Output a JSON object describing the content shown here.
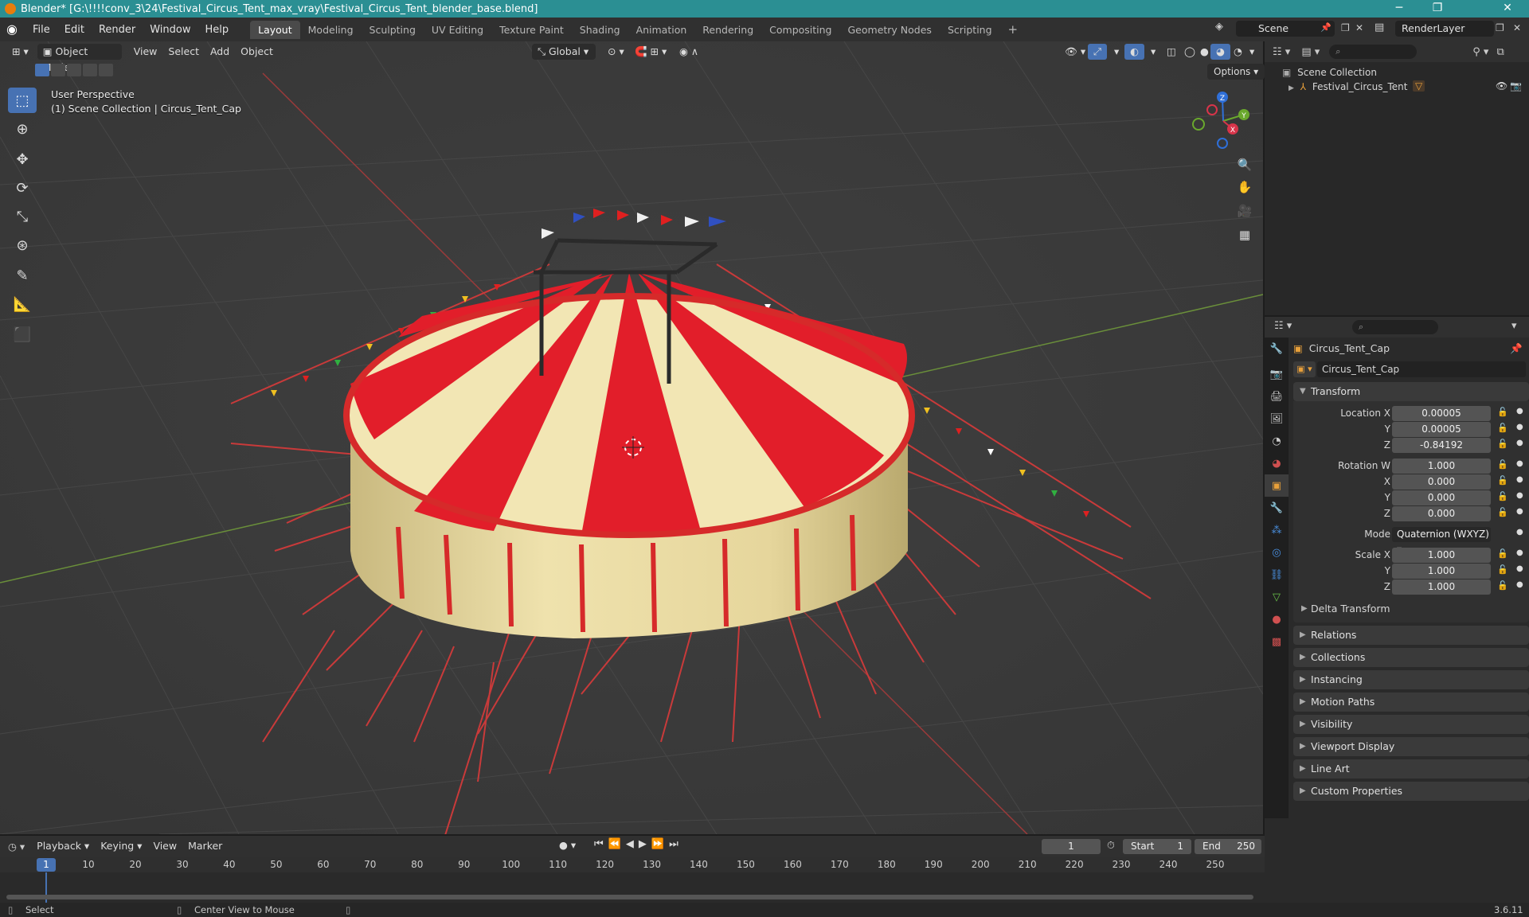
{
  "window": {
    "title": "Blender* [G:\\!!!!conv_3\\24\\Festival_Circus_Tent_max_vray\\Festival_Circus_Tent_blender_base.blend]",
    "minimize": "─",
    "maximize": "❐",
    "close": "✕"
  },
  "menu": [
    "File",
    "Edit",
    "Render",
    "Window",
    "Help"
  ],
  "workspaces": [
    "Layout",
    "Modeling",
    "Sculpting",
    "UV Editing",
    "Texture Paint",
    "Shading",
    "Animation",
    "Rendering",
    "Compositing",
    "Geometry Nodes",
    "Scripting"
  ],
  "workspace_add": "+",
  "scene": {
    "name": "Scene",
    "render_layer": "RenderLayer"
  },
  "viewport": {
    "mode": "Object Mode",
    "menus": [
      "View",
      "Select",
      "Add",
      "Object"
    ],
    "orientation": "Global",
    "options": "Options",
    "info_line1": "User Perspective",
    "info_line2": "(1) Scene Collection | Circus_Tent_Cap",
    "gizmo": {
      "x": "X",
      "y": "Y",
      "z": "Z"
    }
  },
  "outliner": {
    "root": "Scene Collection",
    "items": [
      "Festival_Circus_Tent"
    ]
  },
  "properties": {
    "object_name": "Circus_Tent_Cap",
    "data_name": "Circus_Tent_Cap",
    "transform_title": "Transform",
    "fields": [
      {
        "label": "Location X",
        "value": "0.00005"
      },
      {
        "label": "Y",
        "value": "0.00005"
      },
      {
        "label": "Z",
        "value": "-0.84192"
      },
      {
        "label": "Rotation W",
        "value": "1.000"
      },
      {
        "label": "X",
        "value": "0.000"
      },
      {
        "label": "Y",
        "value": "0.000"
      },
      {
        "label": "Z",
        "value": "0.000"
      },
      {
        "label": "Mode",
        "value": "Quaternion (WXYZ)"
      },
      {
        "label": "Scale X",
        "value": "1.000"
      },
      {
        "label": "Y",
        "value": "1.000"
      },
      {
        "label": "Z",
        "value": "1.000"
      }
    ],
    "delta_transform": "Delta Transform",
    "panels": [
      "Relations",
      "Collections",
      "Instancing",
      "Motion Paths",
      "Visibility",
      "Viewport Display",
      "Line Art",
      "Custom Properties"
    ]
  },
  "timeline": {
    "menus": [
      "Playback",
      "Keying",
      "View",
      "Marker"
    ],
    "current_frame": "1",
    "start_label": "Start",
    "start": "1",
    "end_label": "End",
    "end": "250",
    "ticks": [
      "1",
      "10",
      "20",
      "30",
      "40",
      "50",
      "60",
      "70",
      "80",
      "90",
      "100",
      "110",
      "120",
      "130",
      "140",
      "150",
      "160",
      "170",
      "180",
      "190",
      "200",
      "210",
      "220",
      "230",
      "240",
      "250"
    ]
  },
  "status": {
    "select": "Select",
    "center_view": "Center View to Mouse",
    "version": "3.6.11"
  },
  "colors": {
    "accent": "#4772b3",
    "title_bar": "#2b8f93",
    "tent_red": "#e21e2a",
    "tent_cream": "#f2e6b4"
  }
}
